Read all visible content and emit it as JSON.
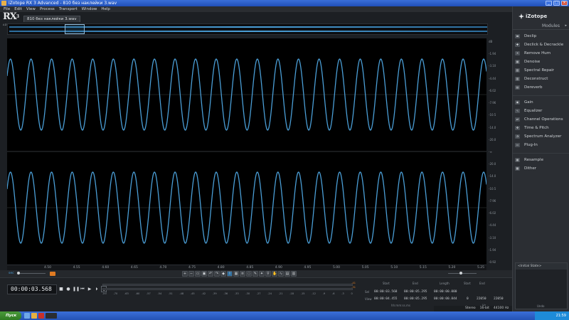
{
  "window": {
    "title": "iZotope RX 3 Advanced - 810 без наклейки 3.wav"
  },
  "menu": [
    "File",
    "Edit",
    "View",
    "Process",
    "Transport",
    "Window",
    "Help"
  ],
  "logo": {
    "text": "RX",
    "superscript": "3",
    "sub": "ADVANCED"
  },
  "file_tab": {
    "label": "810 без наклейки 3.wav"
  },
  "colors": {
    "waveform": "#4a9ed6",
    "accent_orange": "#e07b22",
    "background": "#000000"
  },
  "db_scale": [
    "dB",
    "-1.94",
    "-3.10",
    "-4.44",
    "-6.02",
    "-7.96",
    "-10.5",
    "-14.0",
    "-20.0",
    "-∞",
    "-20.0",
    "-14.0",
    "-10.5",
    "-7.96",
    "-6.02",
    "-4.44",
    "-3.10",
    "-1.94",
    "-0.92"
  ],
  "time_ruler": [
    "4.50",
    "4.55",
    "4.60",
    "4.65",
    "4.70",
    "4.75",
    "4.80",
    "4.85",
    "4.90",
    "4.95",
    "5.00",
    "5.05",
    "5.10",
    "5.15",
    "5.20",
    "5.25"
  ],
  "toolbar": {
    "zoom_label": "sec"
  },
  "transport": {
    "timecode": "00:00:03.568"
  },
  "meter": {
    "labels": [
      "-Inf",
      "-70",
      "-63",
      "-60",
      "-57",
      "-54",
      "-51",
      "-48",
      "-45",
      "-42",
      "-39",
      "-36",
      "-33",
      "-30",
      "-27",
      "-24",
      "-21",
      "-18",
      "-15",
      "-12",
      "-9",
      "-6",
      "-3",
      "0"
    ],
    "peak_top": "-41",
    "peak_bottom": "-31"
  },
  "selection": {
    "headers": [
      "Start",
      "End",
      "Length"
    ],
    "rows": [
      {
        "label": "Sel",
        "values": [
          "00:00:03.568",
          "00:00:05.295",
          "00:00:00.000"
        ]
      },
      {
        "label": "View",
        "values": [
          "00:00:04.455",
          "00:00:05.295",
          "00:00:00.844"
        ]
      }
    ],
    "footer": "hh:mm:ss.ms"
  },
  "range": {
    "headers": [
      "Start",
      "End"
    ],
    "values": [
      "0",
      "22050",
      "22050"
    ],
    "footer": "Hz"
  },
  "status": [
    "Stereo",
    "16-bit",
    "44100 Hz",
    "00:00:04.675",
    "-5.3 dB"
  ],
  "sidebar": {
    "brand": "iZotope",
    "modules_label": "Modules",
    "group1": [
      "Declip",
      "Declick & Decrackle",
      "Remove Hum",
      "Denoise",
      "Spectral Repair",
      "Deconstruct",
      "Dereverb"
    ],
    "group2": [
      "Gain",
      "Equalizer",
      "Channel Operations",
      "Time & Pitch",
      "Spectrum Analyzer",
      "Plug-In"
    ],
    "group3": [
      "Resample",
      "Dither"
    ],
    "history_item": "<Initial State>",
    "undo_label": "Undo"
  },
  "taskbar": {
    "start_label": "Пуск",
    "clock": "21:59"
  }
}
